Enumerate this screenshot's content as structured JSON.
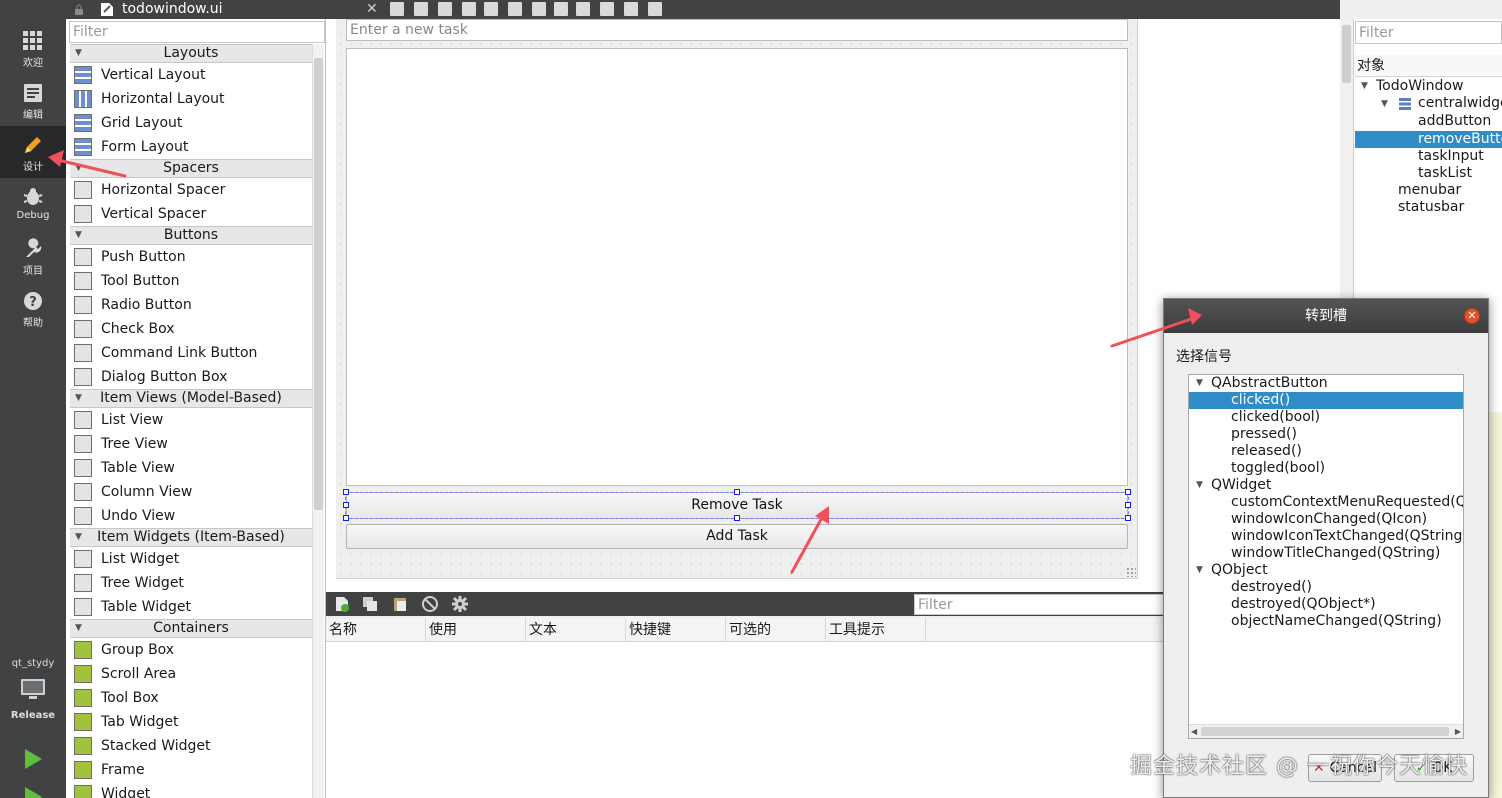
{
  "file": {
    "name": "todowindow.ui"
  },
  "modes": [
    {
      "label": "欢迎",
      "icon": "grid-icon"
    },
    {
      "label": "编辑",
      "icon": "edit-doc-icon"
    },
    {
      "label": "设计",
      "icon": "pencil-icon"
    },
    {
      "label": "Debug",
      "icon": "bug-icon"
    },
    {
      "label": "项目",
      "icon": "wrench-icon"
    },
    {
      "label": "帮助",
      "icon": "help-icon"
    }
  ],
  "kit": {
    "project": "qt_stydy",
    "build": "Release"
  },
  "widget_box": {
    "filter_placeholder": "Filter",
    "categories": [
      {
        "name": "Layouts",
        "items": [
          "Vertical Layout",
          "Horizontal Layout",
          "Grid Layout",
          "Form Layout"
        ]
      },
      {
        "name": "Spacers",
        "items": [
          "Horizontal Spacer",
          "Vertical Spacer"
        ]
      },
      {
        "name": "Buttons",
        "items": [
          "Push Button",
          "Tool Button",
          "Radio Button",
          "Check Box",
          "Command Link Button",
          "Dialog Button Box"
        ]
      },
      {
        "name": "Item Views (Model-Based)",
        "items": [
          "List View",
          "Tree View",
          "Table View",
          "Column View",
          "Undo View"
        ]
      },
      {
        "name": "Item Widgets (Item-Based)",
        "items": [
          "List Widget",
          "Tree Widget",
          "Table Widget"
        ]
      },
      {
        "name": "Containers",
        "items": [
          "Group Box",
          "Scroll Area",
          "Tool Box",
          "Tab Widget",
          "Stacked Widget",
          "Frame",
          "Widget"
        ]
      }
    ]
  },
  "form": {
    "task_placeholder": "Enter a new task",
    "remove_button": "Remove Task",
    "add_button": "Add Task"
  },
  "action_editor": {
    "filter_placeholder": "Filter",
    "columns": [
      "名称",
      "使用",
      "文本",
      "快捷键",
      "可选的",
      "工具提示"
    ]
  },
  "object_inspector": {
    "filter_placeholder": "Filter",
    "header": "对象",
    "nodes": [
      "TodoWindow",
      "centralwidget",
      "addButton",
      "removeButton",
      "taskInput",
      "taskList",
      "menubar",
      "statusbar"
    ],
    "selected": "removeButton"
  },
  "dialog": {
    "title": "转到槽",
    "label": "选择信号",
    "groups": [
      {
        "name": "QAbstractButton",
        "signals": [
          "clicked()",
          "clicked(bool)",
          "pressed()",
          "released()",
          "toggled(bool)"
        ]
      },
      {
        "name": "QWidget",
        "signals": [
          "customContextMenuRequested(QPoint)",
          "windowIconChanged(QIcon)",
          "windowIconTextChanged(QString)",
          "windowTitleChanged(QString)"
        ]
      },
      {
        "name": "QObject",
        "signals": [
          "destroyed()",
          "destroyed(QObject*)",
          "objectNameChanged(QString)"
        ]
      }
    ],
    "selected_signal": "clicked()",
    "cancel": "Cancel",
    "ok": "OK"
  },
  "colors": {
    "accent": "#308cc6",
    "annotation_arrow": "#f0505a",
    "sidebar": "#404244"
  },
  "watermark": "掘金技术社区 @ 一祝你今天愉快"
}
